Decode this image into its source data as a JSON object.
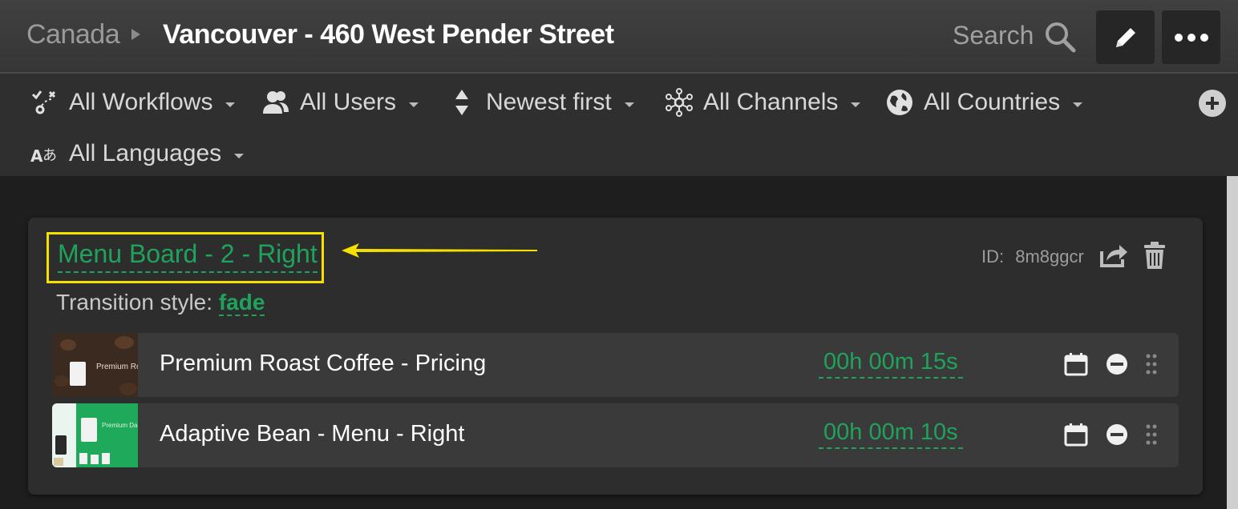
{
  "header": {
    "breadcrumb_parent": "Canada",
    "breadcrumb_current": "Vancouver - 460 West Pender Street",
    "search_label": "Search"
  },
  "filters": [
    {
      "label": "All Workflows",
      "icon": "workflow-icon"
    },
    {
      "label": "All Users",
      "icon": "users-icon"
    },
    {
      "label": "Newest first",
      "icon": "sort-icon"
    },
    {
      "label": "All Channels",
      "icon": "channels-icon"
    },
    {
      "label": "All Countries",
      "icon": "globe-icon"
    },
    {
      "label": "All Languages",
      "icon": "language-icon"
    }
  ],
  "playlist": {
    "name": "Menu Board - 2 - Right",
    "id_label": "ID:",
    "id_value": "8m8ggcr",
    "transition_label": "Transition style:",
    "transition_value": "fade",
    "items": [
      {
        "title": "Premium Roast Coffee - Pricing",
        "duration": "00h 00m 15s",
        "thumb_text": "Premium Roast"
      },
      {
        "title": "Adaptive Bean - Menu - Right",
        "duration": "00h 00m 10s",
        "thumb_text": "Premium Dark Roast"
      }
    ]
  },
  "colors": {
    "accent_green": "#1fa35c",
    "highlight_yellow": "#f5e000",
    "header_bg": "#3b3b3b",
    "card_bg": "#2d2d2d"
  }
}
